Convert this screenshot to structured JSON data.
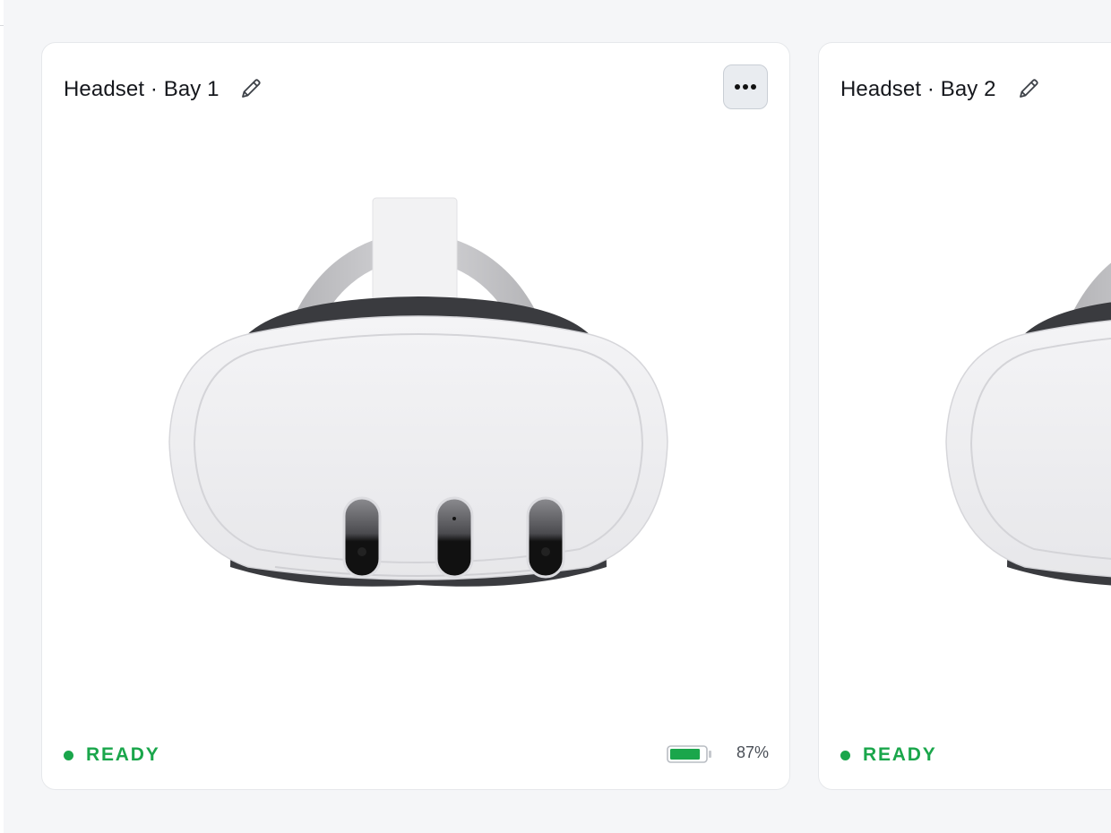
{
  "cards": [
    {
      "title": "Headset · Bay 1",
      "status": "READY",
      "battery_percent": 87,
      "battery_label": "87%",
      "status_color": "#1aa64b"
    },
    {
      "title": "Headset · Bay 2",
      "status": "READY",
      "status_color": "#1aa64b"
    }
  ],
  "icons": {
    "edit": "pencil-icon",
    "more": "more-horizontal-icon",
    "status": "status-dot-icon",
    "battery": "battery-icon"
  },
  "colors": {
    "page_bg": "#f5f6f8",
    "card_bg": "#ffffff",
    "ready": "#1aa64b",
    "battery_fill": "#1aa64b"
  }
}
